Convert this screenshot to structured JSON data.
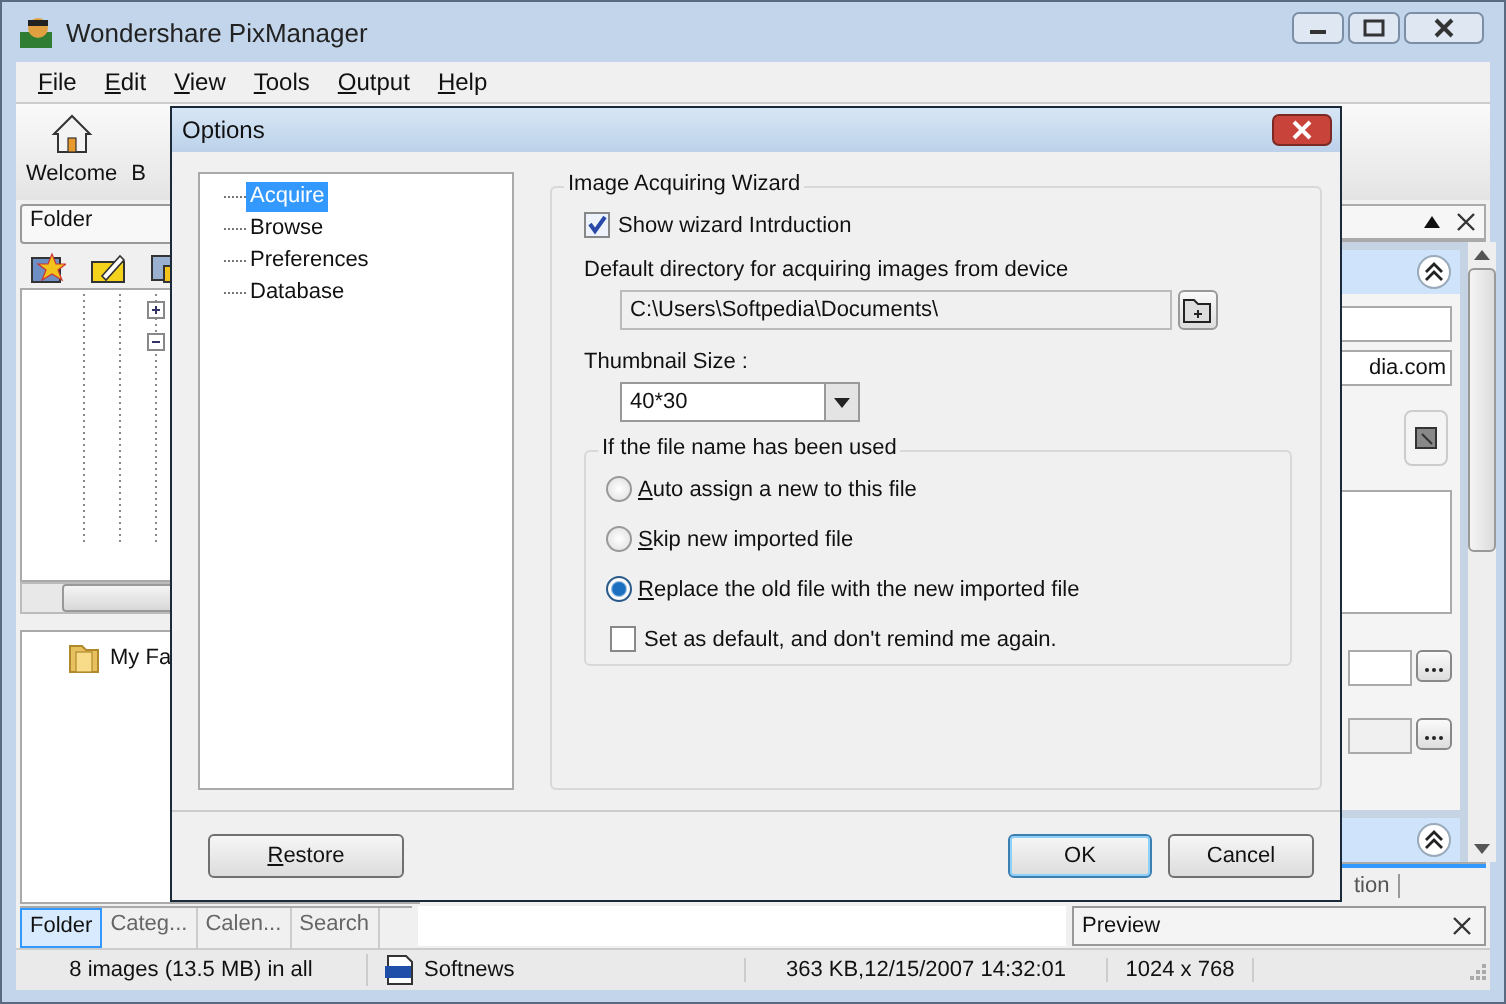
{
  "window": {
    "title": "Wondershare PixManager"
  },
  "menu": [
    {
      "label": "File"
    },
    {
      "label": "Edit"
    },
    {
      "label": "View"
    },
    {
      "label": "Tools"
    },
    {
      "label": "Output"
    },
    {
      "label": "Help"
    }
  ],
  "toolbar": [
    {
      "label": "Welcome"
    },
    {
      "label": "B"
    }
  ],
  "left_panel": {
    "dropdown": "Folder",
    "tree_item": "My Fa"
  },
  "bottom_tabs": [
    {
      "label": "Folder",
      "selected": true
    },
    {
      "label": "Categ...",
      "selected": false
    },
    {
      "label": "Calen...",
      "selected": false
    },
    {
      "label": "Search",
      "selected": false
    }
  ],
  "right_panel": {
    "field_value": "dia.com",
    "tab": "tion"
  },
  "preview_panel": {
    "title": "Preview"
  },
  "status_bar": {
    "summary": "8 images (13.5 MB) in all",
    "file_name": "Softnews",
    "file_info": "363 KB,12/15/2007 14:32:01",
    "dimensions": "1024 x 768"
  },
  "dialog": {
    "title": "Options",
    "nav": [
      {
        "label": "Acquire",
        "selected": true
      },
      {
        "label": "Browse",
        "selected": false
      },
      {
        "label": "Preferences",
        "selected": false
      },
      {
        "label": "Database",
        "selected": false
      }
    ],
    "group_title": "Image Acquiring Wizard",
    "show_intro": {
      "label": "Show wizard Intrduction",
      "checked": true
    },
    "directory_label": "Default directory for acquiring images from device",
    "directory": "C:\\Users\\Softpedia\\Documents\\",
    "thumbnail_label": "Thumbnail Size :",
    "thumbnail_size": "40*30",
    "conflict": {
      "title": "If the file name has been used",
      "options": [
        {
          "label": "Auto assign a new to this file",
          "selected": false
        },
        {
          "label": "Skip new imported file",
          "selected": false
        },
        {
          "label": "Replace the old file with the new imported file",
          "selected": true
        }
      ],
      "remember": {
        "label": "Set as default, and don't remind me again.",
        "checked": false
      }
    },
    "buttons": [
      {
        "label": "Restore",
        "default": false
      },
      {
        "label": "OK",
        "default": true
      },
      {
        "label": "Cancel",
        "default": false
      }
    ]
  }
}
